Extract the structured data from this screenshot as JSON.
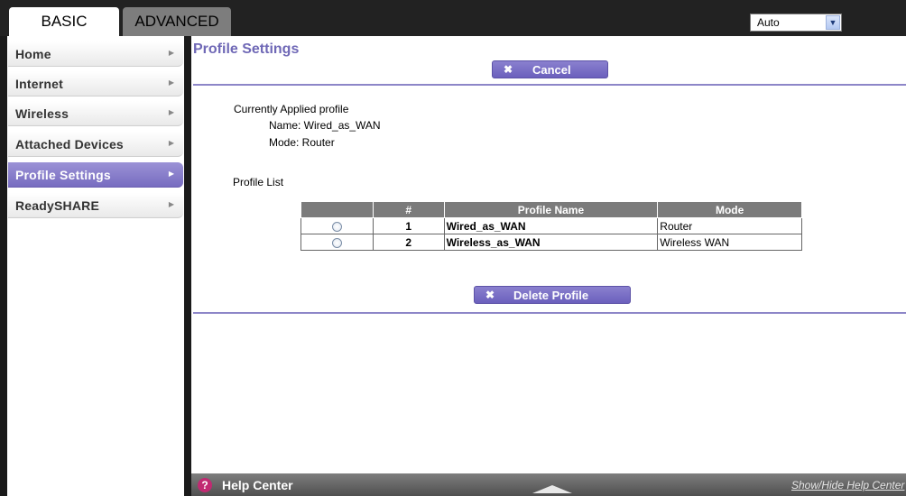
{
  "tabs": {
    "basic": "BASIC",
    "advanced": "ADVANCED"
  },
  "language": {
    "selected": "Auto"
  },
  "sidebar": {
    "items": [
      {
        "label": "Home"
      },
      {
        "label": "Internet"
      },
      {
        "label": "Wireless"
      },
      {
        "label": "Attached Devices"
      },
      {
        "label": "Profile Settings",
        "active": true
      },
      {
        "label": "ReadySHARE"
      }
    ]
  },
  "main": {
    "title": "Profile Settings",
    "cancel_label": "Cancel",
    "current_heading": "Currently Applied profile",
    "current_name": "Name: Wired_as_WAN",
    "current_mode": "Mode: Router",
    "profile_list_label": "Profile List",
    "table": {
      "headers": [
        "#",
        "Profile Name",
        "Mode"
      ],
      "rows": [
        {
          "num": "1",
          "name": "Wired_as_WAN",
          "mode": "Router"
        },
        {
          "num": "2",
          "name": "Wireless_as_WAN",
          "mode": "Wireless WAN"
        }
      ]
    },
    "delete_label": "Delete Profile"
  },
  "help": {
    "label": "Help Center",
    "link": "Show/Hide Help Center"
  },
  "colors": {
    "accent": "#7a70c4",
    "title": "#6f68b6",
    "help_icon": "#c12a72"
  }
}
